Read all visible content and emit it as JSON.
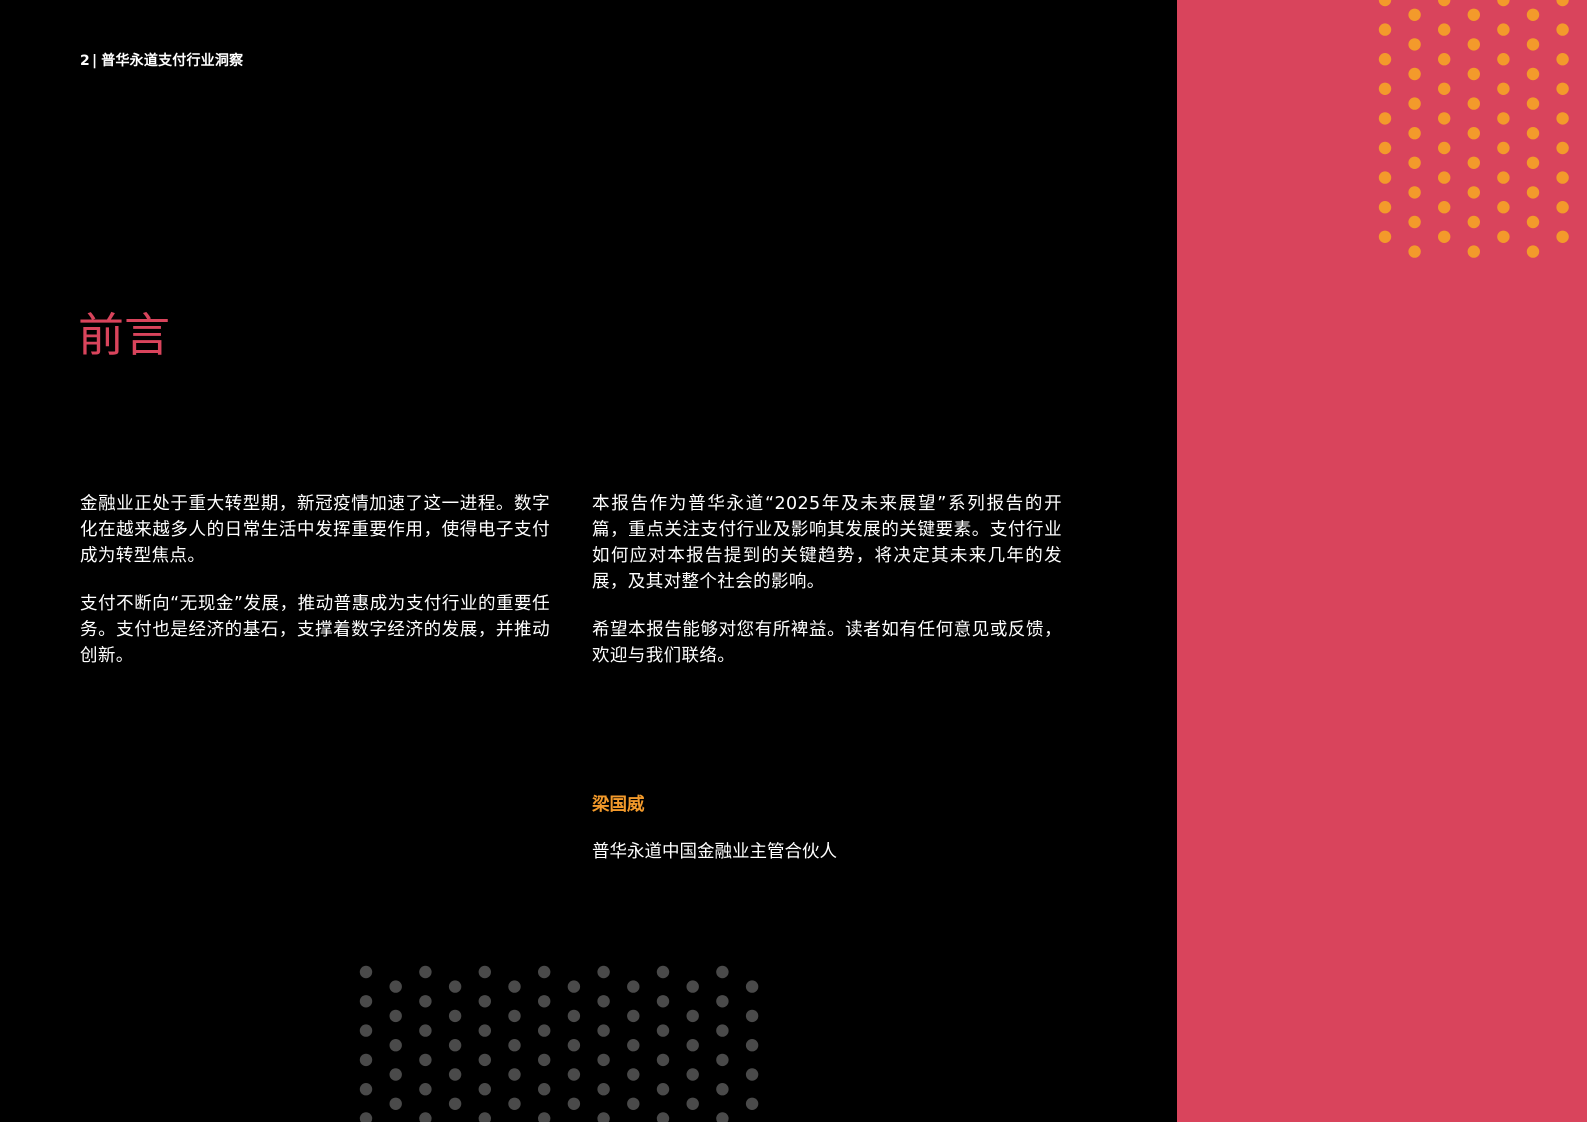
{
  "header": {
    "page_number": "2",
    "separator": "|",
    "report_title": "普华永道支付行业洞察"
  },
  "section": {
    "title": "前言"
  },
  "left_column": {
    "paragraphs": [
      "金融业正处于重大转型期，新冠疫情加速了这一进程。数字化在越来越多人的日常生活中发挥重要作用，使得电子支付成为转型焦点。",
      "支付不断向“无现金”发展，推动普惠成为支付行业的重要任务。支付也是经济的基石，支撑着数字经济的发展，并推动创新。"
    ]
  },
  "right_column": {
    "paragraphs": [
      "本报告作为普华永道“2025年及未来展望”系列报告的开篇，重点关注支付行业及影响其发展的关键要素。支付行业如何应对本报告提到的关键趋势，将决定其未来几年的发展，及其对整个社会的影响。",
      "希望本报告能够对您有所裨益。读者如有任何意见或反馈，欢迎与我们联络。"
    ]
  },
  "signature": {
    "name": "梁国威",
    "title": "普华永道中国金融业主管合伙人"
  },
  "colors": {
    "background": "#000000",
    "accent_panel": "#d9445c",
    "title": "#d9445c",
    "signature_name": "#f39a2b",
    "orange_dots": "#f39a2b",
    "grey_dots": "#4a4a4a",
    "body_text": "#ffffff"
  }
}
